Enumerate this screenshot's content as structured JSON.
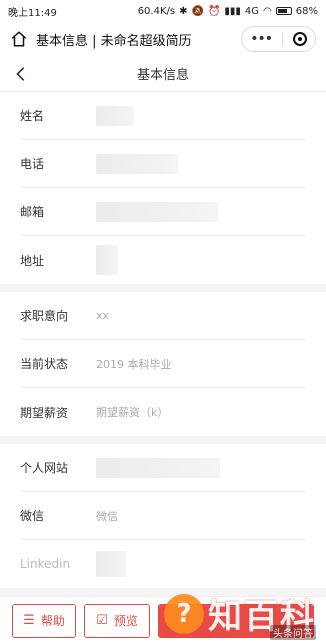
{
  "status": {
    "time": "晚上11:49",
    "speed": "60.4K/s",
    "network": "4G",
    "battery": "68%"
  },
  "miniapp": {
    "title": "基本信息 | 未命名超级简历",
    "more": "•••"
  },
  "nav": {
    "title": "基本信息"
  },
  "sections": [
    {
      "rows": [
        {
          "label": "姓名",
          "value": ""
        },
        {
          "label": "电话",
          "value": ""
        },
        {
          "label": "邮箱",
          "value": ""
        },
        {
          "label": "地址",
          "value": ""
        }
      ]
    },
    {
      "rows": [
        {
          "label": "求职意向",
          "value": "xx"
        },
        {
          "label": "当前状态",
          "value": "2019 本科毕业"
        },
        {
          "label": "期望薪资",
          "value": "期望薪资（k）"
        }
      ]
    },
    {
      "rows": [
        {
          "label": "个人网站",
          "value": ""
        },
        {
          "label": "微信",
          "value": "微信"
        },
        {
          "label": "Linkedin",
          "value": ""
        }
      ]
    }
  ],
  "footer": {
    "help_label": "帮助",
    "preview_label": "预览",
    "save_label": ""
  },
  "watermark": {
    "main": "知百科",
    "sub": "头条问答"
  },
  "colors": {
    "accent": "#e84a45",
    "watermark": "#ff8a1f"
  }
}
